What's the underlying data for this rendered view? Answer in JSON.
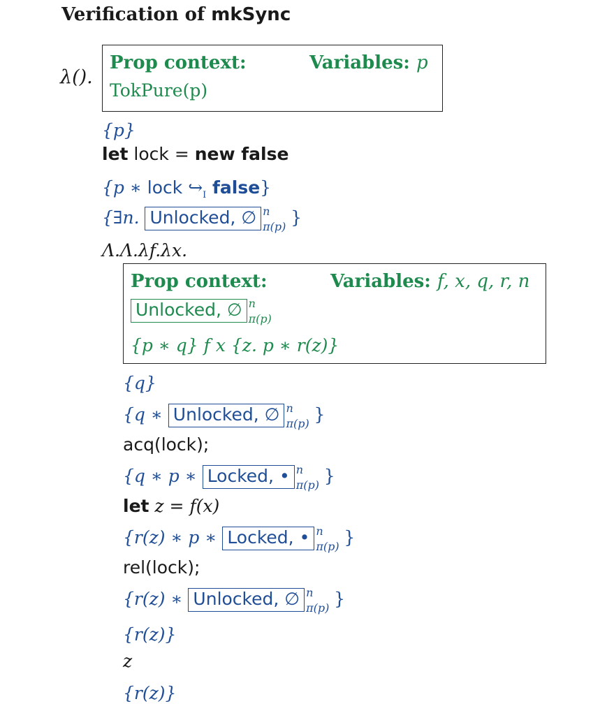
{
  "title": {
    "prefix": "Verification of ",
    "name": "mkSync"
  },
  "lambda_unit": "λ().",
  "ctx1": {
    "prop_label": "Prop context:",
    "prop_value": "TokPure(p)",
    "vars_label": "Variables:",
    "vars_value": "p"
  },
  "pre_p": "{p}",
  "let_kw": "let",
  "lock_word": " lock ",
  "eq": "= ",
  "new_false": "new false",
  "assert_pts": {
    "open": "{p ∗ ",
    "lock": "lock ",
    "arrow": "↪",
    "sub": "I",
    "false": " false",
    "close": "}"
  },
  "assert_exists": {
    "open": "{∃n. ",
    "ghost": "Unlocked, ∅",
    "sup": "n",
    "sub": "π(p)",
    "close": "}"
  },
  "lambda_line": "Λ.Λ.λf.λx.",
  "ctx2": {
    "prop_label": "Prop context:",
    "vars_label": "Variables:",
    "vars_value": "f, x, q, r, n",
    "ghost": "Unlocked, ∅",
    "sup": "n",
    "sub": "π(p)",
    "triple": "{p ∗ q}  f x  {z. p ∗ r(z)}"
  },
  "body": {
    "q": "{q}",
    "a1": {
      "open": "{q ∗ ",
      "ghost": "Unlocked, ∅",
      "sup": "n",
      "sub": "π(p)",
      "close": "}"
    },
    "acq": "acq(lock);",
    "a2": {
      "open": "{q ∗ p ∗ ",
      "ghost": "Locked, •",
      "sup": "n",
      "sub": "π(p)",
      "close": "}"
    },
    "let_kw": "let",
    "let_rest": " z = f(x)",
    "a3": {
      "open": "{r(z) ∗ p ∗ ",
      "ghost": "Locked, •",
      "sup": "n",
      "sub": "π(p)",
      "close": "}"
    },
    "rel": "rel(lock);",
    "a4": {
      "open": "{r(z) ∗ ",
      "ghost": "Unlocked, ∅",
      "sup": "n",
      "sub": "π(p)",
      "close": "}"
    },
    "rz1": "{r(z)}",
    "z": "z",
    "rz2": "{r(z)}"
  }
}
